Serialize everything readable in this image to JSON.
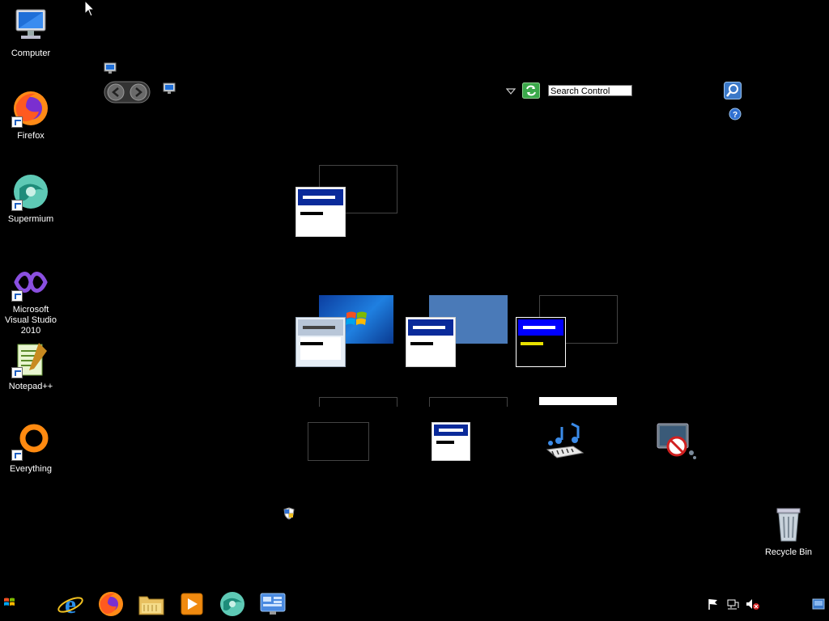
{
  "desktop_icons": [
    {
      "label": "Computer"
    },
    {
      "label": "Firefox"
    },
    {
      "label": "Supermium"
    },
    {
      "label": "Microsoft Visual Studio 2010"
    },
    {
      "label": "Notepad++"
    },
    {
      "label": "Everything"
    }
  ],
  "recycle_bin": {
    "label": "Recycle Bin"
  },
  "control_panel": {
    "search_placeholder": "Search Control Panel"
  },
  "colors": {
    "background": "#000000",
    "titlebar_blue": "#0a2a9a",
    "accent_blue": "#2f6fd0"
  }
}
